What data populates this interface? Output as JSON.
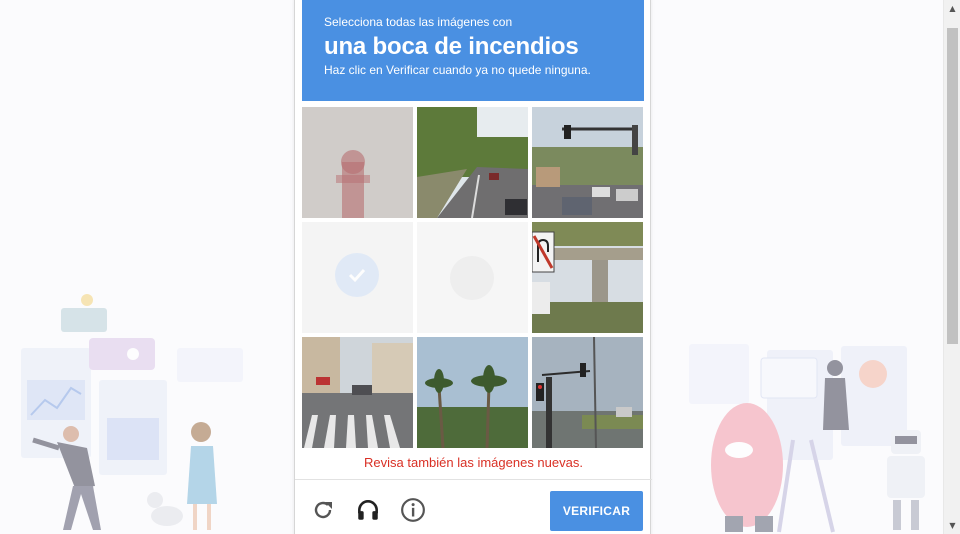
{
  "captcha": {
    "instruction_line1": "Selecciona todas las imágenes con",
    "target": "una boca de incendios",
    "instruction_line3": "Haz clic en Verificar cuando ya no quede ninguna.",
    "error_message": "Revisa también las imágenes nuevas.",
    "verify_label": "VERIFICAR",
    "tiles": [
      {
        "content": "fire hydrant (faded, loading)",
        "state": "loading"
      },
      {
        "content": "road with trees",
        "state": "normal"
      },
      {
        "content": "street intersection with traffic light",
        "state": "normal"
      },
      {
        "content": "selected tile",
        "state": "selected-faded"
      },
      {
        "content": "blank tile",
        "state": "faded"
      },
      {
        "content": "overpass with no-U-turn sign",
        "state": "normal"
      },
      {
        "content": "crosswalk in city street",
        "state": "normal"
      },
      {
        "content": "palm trees",
        "state": "normal"
      },
      {
        "content": "traffic light at intersection",
        "state": "normal"
      }
    ],
    "icons": [
      "reload-icon",
      "headphones-icon",
      "info-icon"
    ]
  },
  "colors": {
    "header_bg": "#4a90e2",
    "verify_bg": "#4a90e2",
    "error": "#d93025"
  }
}
